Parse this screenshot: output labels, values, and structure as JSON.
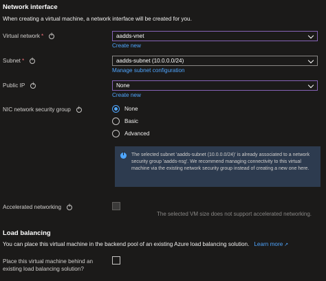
{
  "network_interface": {
    "title": "Network interface",
    "description": "When creating a virtual machine, a network interface will be created for you."
  },
  "virtual_network": {
    "label": "Virtual network",
    "required_mark": "*",
    "value": "aadds-vnet",
    "create_link": "Create new"
  },
  "subnet": {
    "label": "Subnet",
    "required_mark": "*",
    "value": "aadds-subnet (10.0.0.0/24)",
    "manage_link": "Manage subnet configuration"
  },
  "public_ip": {
    "label": "Public IP",
    "value": "None",
    "create_link": "Create new"
  },
  "nsg": {
    "label": "NIC network security group",
    "options": [
      "None",
      "Basic",
      "Advanced"
    ],
    "selected": "None",
    "info": "The selected subnet 'aadds-subnet (10.0.0.0/24)' is already associated to a network security group 'aadds-nsg'. We recommend managing connectivity to this virtual machine via the existing network security group instead of creating a new one here."
  },
  "accelerated_networking": {
    "label": "Accelerated networking",
    "checked": false,
    "disabled": true,
    "hint": "The selected VM size does not support accelerated networking."
  },
  "load_balancing": {
    "title": "Load balancing",
    "description": "You can place this virtual machine in the backend pool of an existing Azure load balancing solution.",
    "learn_more": "Learn more",
    "place_label_line1": "Place this virtual machine behind an",
    "place_label_line2": "existing load balancing solution?",
    "checked": false
  },
  "colors": {
    "background": "#1b1a19",
    "accent": "#4fa6ff",
    "focus_border": "#8764b8",
    "info_box": "#2d3b4f"
  }
}
